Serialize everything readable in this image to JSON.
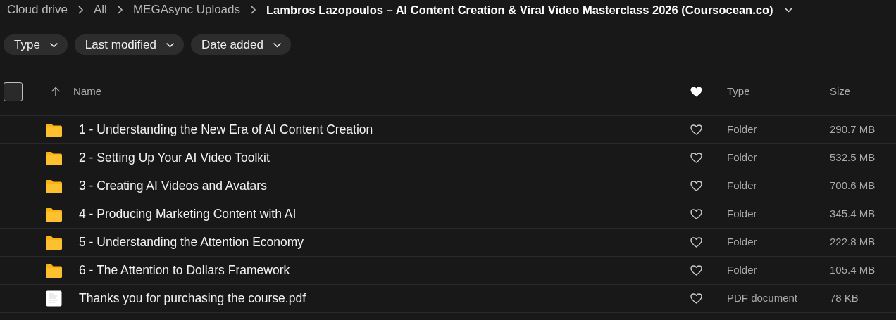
{
  "breadcrumb": [
    {
      "label": "Cloud drive",
      "current": false
    },
    {
      "label": "All",
      "current": false
    },
    {
      "label": "MEGAsync Uploads",
      "current": false
    },
    {
      "label": "Lambros Lazopoulos – AI Content Creation & Viral Video Masterclass 2026 (Coursocean.co)",
      "current": true
    }
  ],
  "filters": [
    {
      "label": "Type"
    },
    {
      "label": "Last modified"
    },
    {
      "label": "Date added"
    }
  ],
  "table": {
    "select_all": {
      "checked": false
    },
    "columns": [
      {
        "label": "Name",
        "sorted": true
      },
      {
        "kind": "favourite"
      },
      {
        "label": "Type"
      },
      {
        "label": "Size"
      }
    ],
    "rows": [
      {
        "kind": "folder",
        "name": "1 - Understanding the New Era of AI Content Creation",
        "favourite": false,
        "type": "Folder",
        "size": "290.7 MB"
      },
      {
        "kind": "folder",
        "name": "2 - Setting Up Your AI Video Toolkit",
        "favourite": false,
        "type": "Folder",
        "size": "532.5 MB"
      },
      {
        "kind": "folder",
        "name": "3 - Creating AI Videos and Avatars",
        "favourite": false,
        "type": "Folder",
        "size": "700.6 MB"
      },
      {
        "kind": "folder",
        "name": "4 - Producing Marketing Content with AI",
        "favourite": false,
        "type": "Folder",
        "size": "345.4 MB"
      },
      {
        "kind": "folder",
        "name": "5 - Understanding the Attention Economy",
        "favourite": false,
        "type": "Folder",
        "size": "222.8 MB"
      },
      {
        "kind": "folder",
        "name": "6 - The Attention to Dollars Framework",
        "favourite": false,
        "type": "Folder",
        "size": "105.4 MB"
      },
      {
        "kind": "pdf",
        "name": "Thanks you for purchasing the course.pdf",
        "favourite": false,
        "type": "PDF document",
        "size": "78 KB"
      }
    ]
  }
}
